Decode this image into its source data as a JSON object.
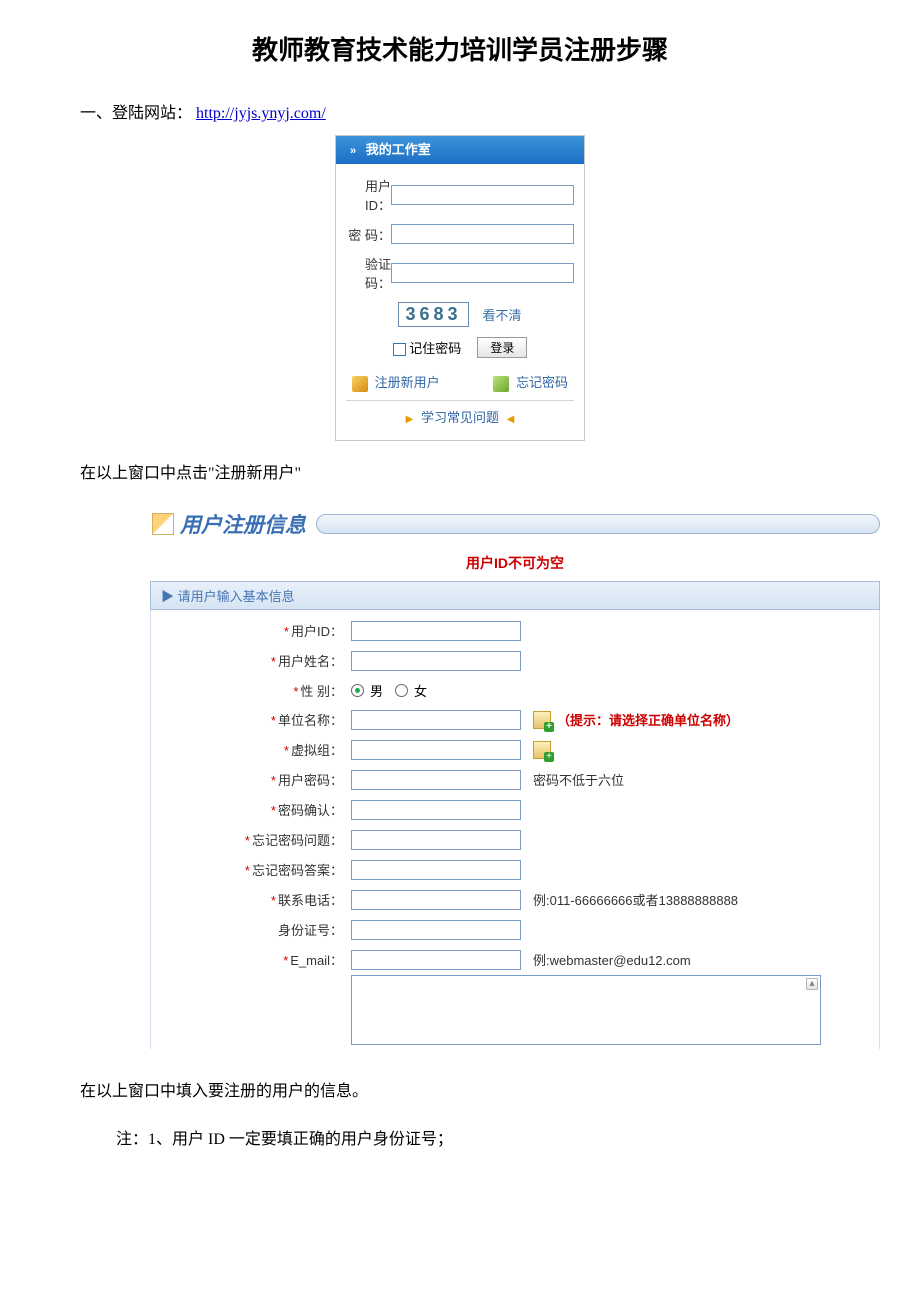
{
  "doc": {
    "title": "教师教育技术能力培训学员注册步骤",
    "step1_label": "一、登陆网站：",
    "url": "http://jyjs.ynyj.com/",
    "caption_after_login": "在以上窗口中点击\"注册新用户\"",
    "caption_after_reg": "在以上窗口中填入要注册的用户的信息。",
    "note1": "注：1、用户 ID 一定要填正确的用户身份证号；"
  },
  "login": {
    "header": "我的工作室",
    "labels": {
      "user": "用户ID：",
      "pwd": "密  码：",
      "captcha": "验证码："
    },
    "captcha_value": "3683",
    "refresh": "看不清",
    "remember": "记住密码",
    "login_btn": "登录",
    "register": "注册新用户",
    "forgot": "忘记密码",
    "faq": "学习常见问题"
  },
  "reg": {
    "title": "用户注册信息",
    "error": "用户ID不可为空",
    "subhead": "▶  请用户输入基本信息",
    "fields": {
      "user_id": "用户ID：",
      "user_name": "用户姓名：",
      "gender": "性  别：",
      "org": "单位名称：",
      "vgroup": "虚拟组：",
      "pwd": "用户密码：",
      "pwd2": "密码确认：",
      "q": "忘记密码问题：",
      "a": "忘记密码答案：",
      "phone": "联系电话：",
      "idno": "身份证号：",
      "email": "E_mail："
    },
    "gender_male": "男",
    "gender_female": "女",
    "org_hint": "（提示：请选择正确单位名称）",
    "pwd_hint": "密码不低于六位",
    "phone_hint": "例:011-66666666或者13888888888",
    "email_hint": "例:webmaster@edu12.com"
  }
}
